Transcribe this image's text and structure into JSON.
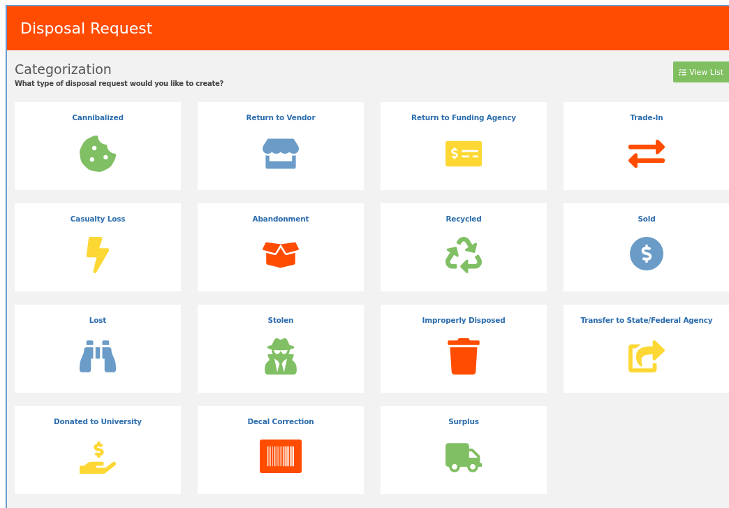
{
  "header": {
    "title": "Disposal Request"
  },
  "section": {
    "title": "Categorization",
    "subtitle": "What type of disposal request would you like to create?"
  },
  "view_list_button": {
    "label": "View List"
  },
  "cards": [
    {
      "label": "Cannibalized",
      "color": "#80bf64"
    },
    {
      "label": "Return to Vendor",
      "color": "#6b9cc8"
    },
    {
      "label": "Return to Funding Agency",
      "color": "#fdd835"
    },
    {
      "label": "Trade-In",
      "color": "#ff4c00"
    },
    {
      "label": "Casualty Loss",
      "color": "#fdd835"
    },
    {
      "label": "Abandonment",
      "color": "#ff4c00"
    },
    {
      "label": "Recycled",
      "color": "#80bf64"
    },
    {
      "label": "Sold",
      "color": "#6b9cc8"
    },
    {
      "label": "Lost",
      "color": "#6b9cc8"
    },
    {
      "label": "Stolen",
      "color": "#80bf64"
    },
    {
      "label": "Improperly Disposed",
      "color": "#ff4c00"
    },
    {
      "label": "Transfer to State/Federal Agency",
      "color": "#fdd835"
    },
    {
      "label": "Donated to University",
      "color": "#fdd835"
    },
    {
      "label": "Decal Correction",
      "color": "#ff4c00"
    },
    {
      "label": "Surplus",
      "color": "#80bf64"
    }
  ]
}
